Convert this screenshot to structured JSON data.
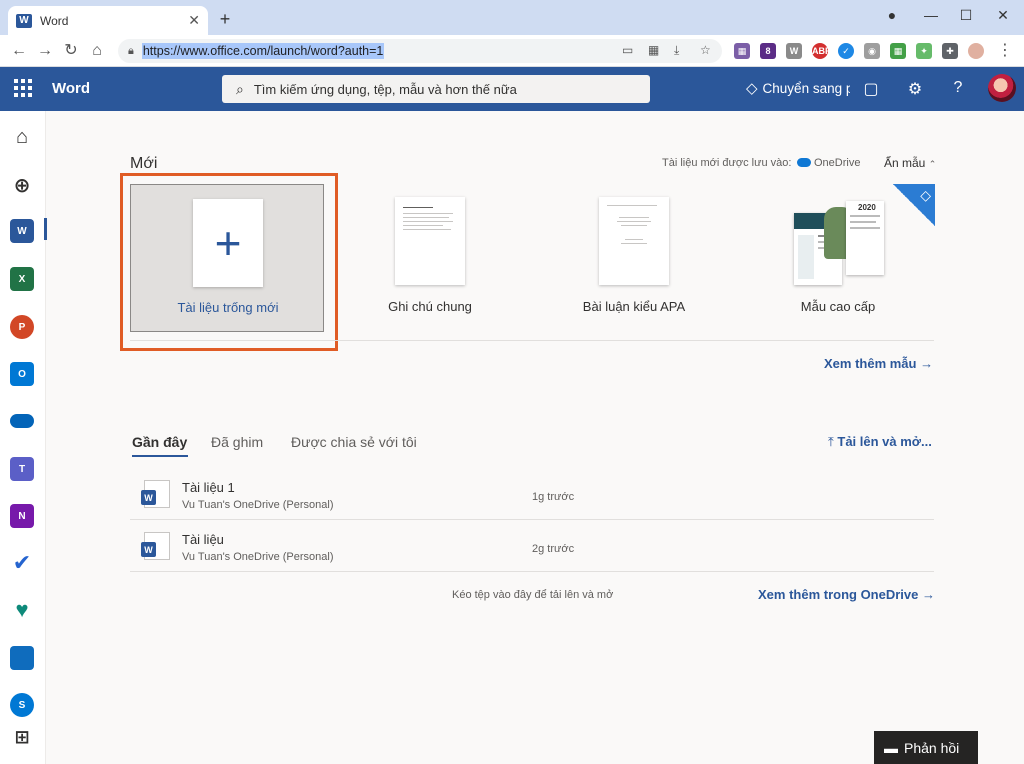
{
  "browser": {
    "tab_title": "Word",
    "url": "https://www.office.com/launch/word?auth=1"
  },
  "header": {
    "app_name": "Word",
    "search_placeholder": "Tìm kiếm ứng dụng, tệp, mẫu và hơn thế nữa",
    "premium_label": "Chuyển sang p",
    "help_label": "?"
  },
  "new_section": {
    "title": "Mới",
    "save_location_label": "Tài liệu mới được lưu vào:",
    "save_location_value": "OneDrive",
    "hide_templates": "Ẩn mẫu",
    "templates": [
      {
        "label": "Tài liệu trống mới"
      },
      {
        "label": "Ghi chú chung"
      },
      {
        "label": "Bài luận kiểu APA"
      },
      {
        "label": "Mẫu cao cấp"
      }
    ],
    "resume_year": "2020",
    "more_templates": "Xem thêm mẫu"
  },
  "recent_section": {
    "tabs": [
      "Gần đây",
      "Đã ghim",
      "Được chia sẻ với tôi"
    ],
    "upload": "Tải lên và mở...",
    "files": [
      {
        "name": "Tài liệu 1",
        "location": "Vu Tuan's OneDrive (Personal)",
        "time": "1g trước"
      },
      {
        "name": "Tài liệu",
        "location": "Vu Tuan's OneDrive (Personal)",
        "time": "2g trước"
      }
    ],
    "drop_hint": "Kéo tệp vào đây để tải lên và mở",
    "more_onedrive": "Xem thêm trong OneDrive"
  },
  "feedback": "Phản hồi",
  "colors": {
    "word_blue": "#2b579a",
    "highlight_border": "#e05c25"
  }
}
